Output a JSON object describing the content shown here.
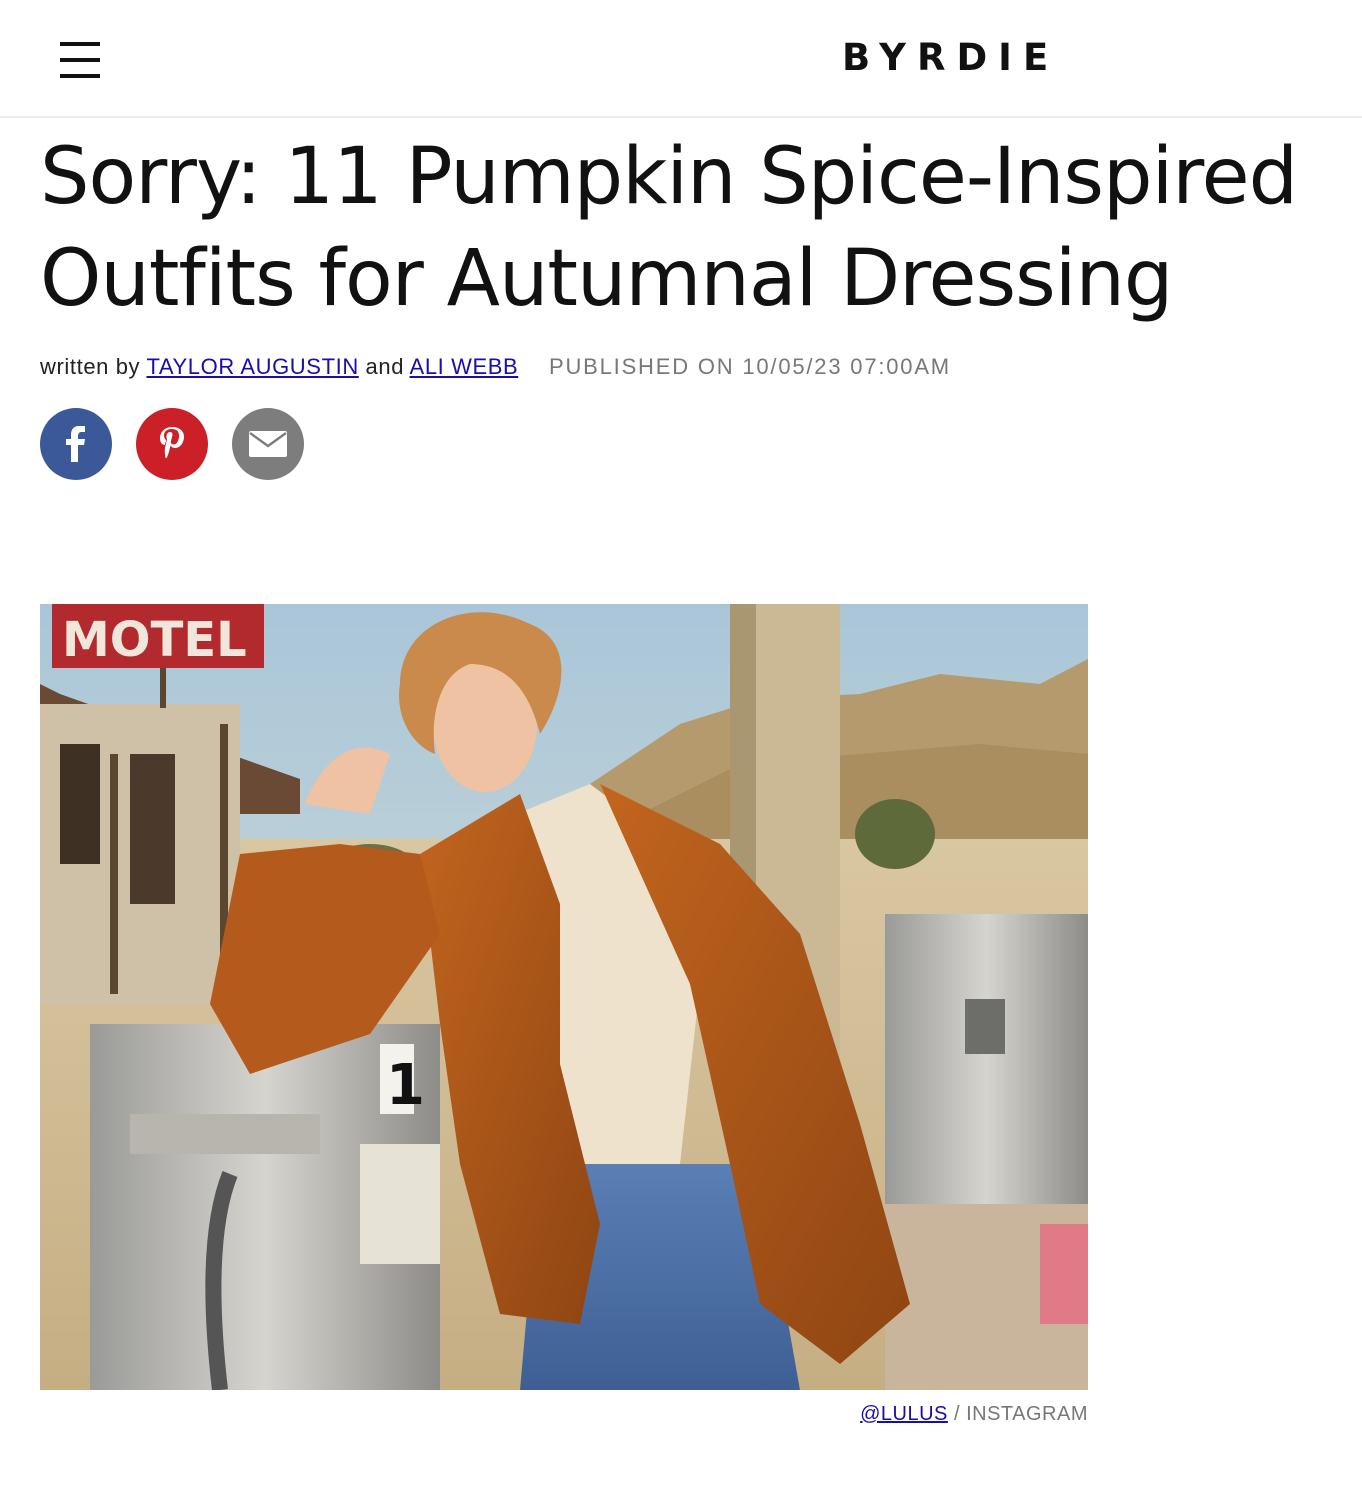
{
  "header": {
    "logo": "BYRDIE",
    "menu_icon": "hamburger-menu-icon"
  },
  "article": {
    "title": "Sorry: 11 Pumpkin Spice-Inspired Outfits for Autumnal Dressing",
    "byline": {
      "prefix": "written by",
      "author1": "TAYLOR AUGUSTIN",
      "conjunction": "and",
      "author2": "ALI WEBB",
      "published": "PUBLISHED ON 10/05/23 07:00AM"
    },
    "share": [
      {
        "name": "facebook",
        "icon": "facebook-icon",
        "color": "#3b5998"
      },
      {
        "name": "pinterest",
        "icon": "pinterest-icon",
        "color": "#cb2027"
      },
      {
        "name": "email",
        "icon": "email-icon",
        "color": "#7d7d7d"
      }
    ],
    "hero_image": {
      "sign_text": "MOTEL",
      "pump_number": "1",
      "credit_link": "@LULUS",
      "credit_separator": "/",
      "credit_source": "INSTAGRAM"
    }
  }
}
